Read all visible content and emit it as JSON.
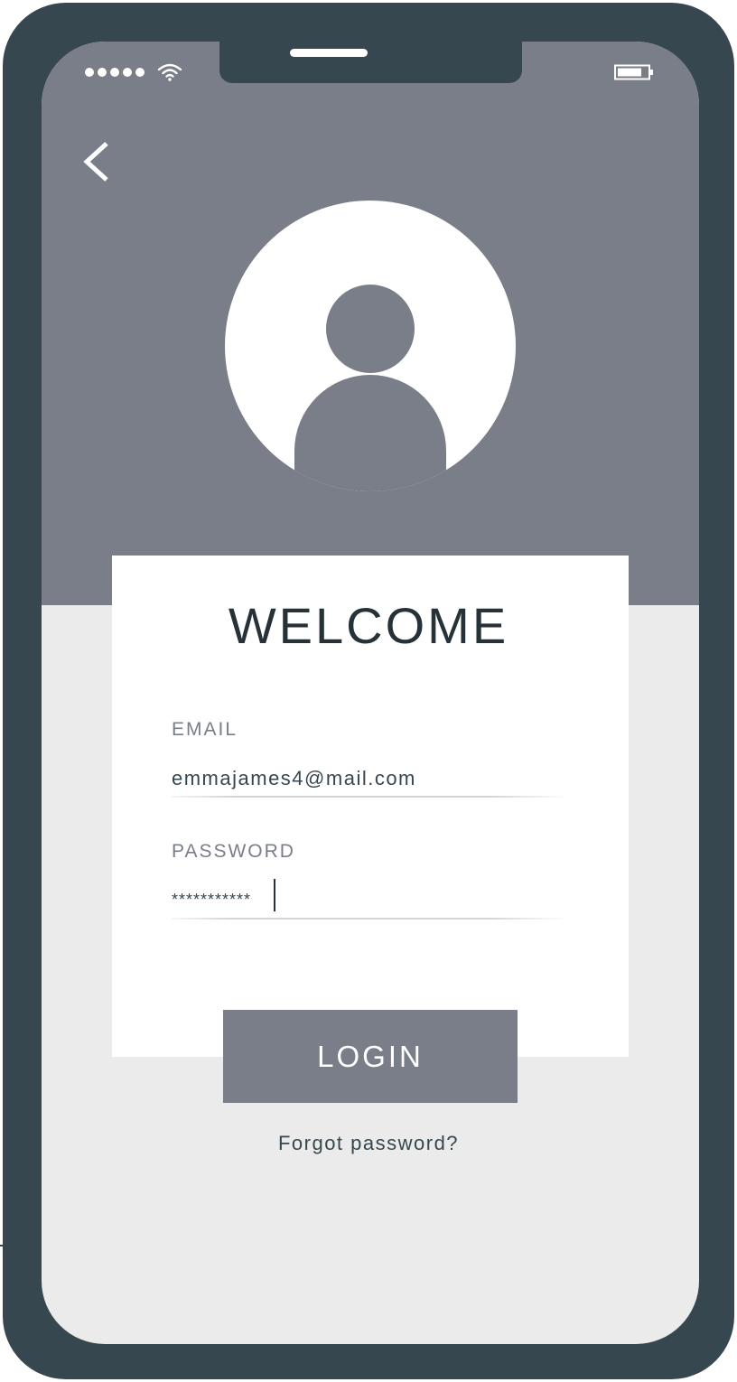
{
  "status_bar": {
    "signal_icon": "signal-dots-icon",
    "wifi_icon": "wifi-icon",
    "battery_icon": "battery-icon"
  },
  "header": {
    "back_icon": "chevron-left-icon"
  },
  "profile": {
    "avatar_icon": "user-avatar-icon"
  },
  "login_form": {
    "title": "WELCOME",
    "email_label": "EMAIL",
    "email_value": "emmajames4@mail.com",
    "password_label": "PASSWORD",
    "password_value": "***********",
    "login_label": "LOGIN",
    "forgot_label": "Forgot password?"
  },
  "colors": {
    "frame": "#37474f",
    "header_bg": "#7a7e89",
    "screen_bg": "#ebebeb",
    "card_bg": "#ffffff",
    "title_text": "#263238",
    "button_bg": "#7a7e89",
    "button_text": "#ffffff"
  }
}
